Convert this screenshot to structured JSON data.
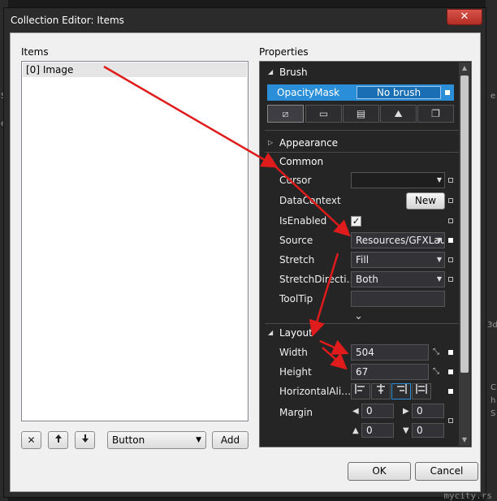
{
  "window": {
    "title": "Collection Editor: Items",
    "close_glyph": "✕"
  },
  "background": {
    "left_text_1": "S",
    "left_text_2": "e",
    "right_text_1": "e",
    "right_text_2": "C",
    "right_text_3": "h",
    "right_text_4": "S",
    "right_text_5": "3d"
  },
  "items_panel": {
    "label": "Items",
    "items": [
      {
        "label": "[0] Image"
      }
    ],
    "toolbar": {
      "remove_glyph": "✕",
      "up_glyph": "🡑",
      "down_glyph": "🡓",
      "type_selected": "Button",
      "add_label": "Add"
    }
  },
  "properties": {
    "label": "Properties",
    "brush_category": "Brush",
    "opacity_mask": {
      "label": "OpacityMask",
      "value": "No brush"
    },
    "brush_tabs": [
      "⧄",
      "▭",
      "▤",
      "⛰",
      "❐"
    ],
    "appearance_category": "Appearance",
    "common_category": "Common",
    "common_rows": {
      "cursor": {
        "label": "Cursor",
        "value": ""
      },
      "datacontext": {
        "label": "DataContext",
        "button": "New"
      },
      "isenabled": {
        "label": "IsEnabled",
        "checked_glyph": "✓"
      },
      "source": {
        "label": "Source",
        "value": "Resources/GFXLau"
      },
      "stretch": {
        "label": "Stretch",
        "value": "Fill"
      },
      "stretchdirection": {
        "label": "StretchDirecti…",
        "value": "Both"
      },
      "tooltip": {
        "label": "ToolTip",
        "value": ""
      }
    },
    "expand_glyph": "⌄",
    "layout_category": "Layout",
    "layout_rows": {
      "width": {
        "label": "Width",
        "value": "504"
      },
      "height": {
        "label": "Height",
        "value": "67"
      },
      "horizontal": {
        "label": "HorizontalAli…"
      },
      "margin": {
        "label": "Margin",
        "left": "0",
        "top": "0",
        "right": "0",
        "bottom": "0"
      }
    },
    "align_icons": [
      "left-align-icon",
      "center-align-icon",
      "right-align-icon",
      "stretch-align-icon"
    ]
  },
  "footer": {
    "ok_label": "OK",
    "cancel_label": "Cancel",
    "watermark": "mycity.rs"
  },
  "colors": {
    "accent": "#2a8fd8",
    "arrow": "#e01b1b",
    "panel_bg": "#252526"
  }
}
